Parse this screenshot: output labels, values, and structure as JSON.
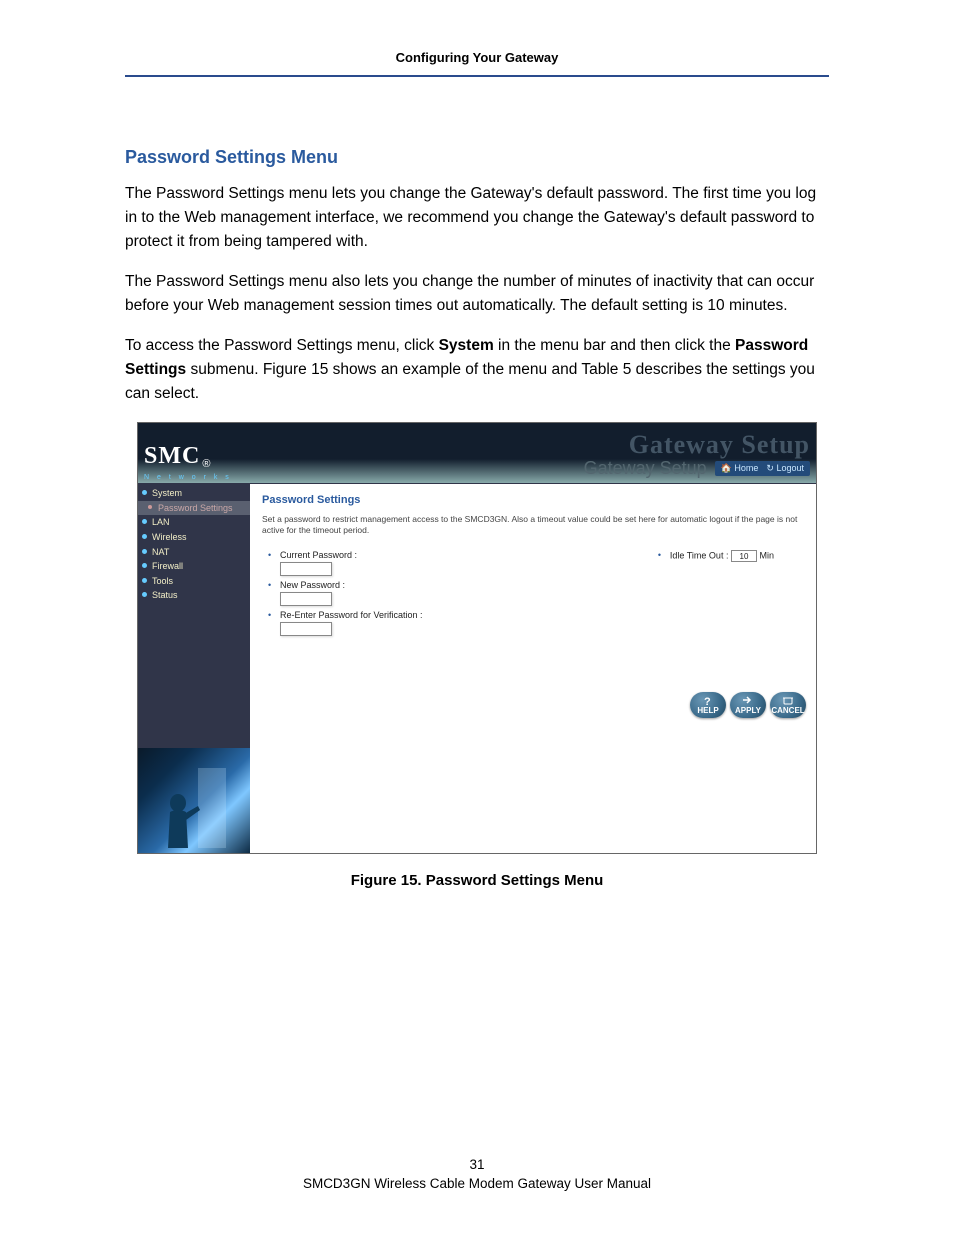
{
  "header": {
    "title": "Configuring Your Gateway"
  },
  "section": {
    "title": "Password Settings Menu",
    "p1": "The Password Settings menu lets you change the Gateway's default password. The first time you log in to the Web management interface, we recommend you change the Gateway's default password to protect it from being tampered with.",
    "p2": "The Password Settings menu also lets you change the number of minutes of inactivity that can occur before your Web management session times out automatically. The default setting is 10 minutes.",
    "p3a": "To access the Password Settings menu, click ",
    "p3b_bold": "System",
    "p3c": " in the menu bar and then click the ",
    "p3d_bold": "Password Settings",
    "p3e": " submenu. Figure 15 shows an example of the menu and Table 5 describes the settings you can select."
  },
  "screenshot": {
    "logo": {
      "main": "SMC",
      "reg": "®",
      "sub": "N e t w o r k s"
    },
    "topright": {
      "watermark": "Gateway Setup",
      "title": "Gateway Setup",
      "home": "Home",
      "logout": "Logout"
    },
    "sidebar": {
      "items": [
        {
          "label": "System",
          "sub": false
        },
        {
          "label": "Password Settings",
          "sub": true
        },
        {
          "label": "LAN",
          "sub": false
        },
        {
          "label": "Wireless",
          "sub": false
        },
        {
          "label": "NAT",
          "sub": false
        },
        {
          "label": "Firewall",
          "sub": false
        },
        {
          "label": "Tools",
          "sub": false
        },
        {
          "label": "Status",
          "sub": false
        }
      ]
    },
    "content": {
      "heading": "Password Settings",
      "desc": "Set a password to restrict management access to the SMCD3GN. Also a timeout value could be set here for automatic logout if the page is not active for the timeout period.",
      "fields": {
        "current": "Current Password :",
        "new": "New Password :",
        "confirm": "Re-Enter Password for Verification :",
        "idle_label": "Idle Time Out :",
        "idle_value": "10",
        "idle_unit": "Min"
      },
      "buttons": {
        "help": "HELP",
        "apply": "APPLY",
        "cancel": "CANCEL"
      }
    }
  },
  "figure_caption": "Figure 15. Password Settings Menu",
  "footer": {
    "page": "31",
    "line": "SMCD3GN Wireless Cable Modem Gateway User Manual"
  }
}
